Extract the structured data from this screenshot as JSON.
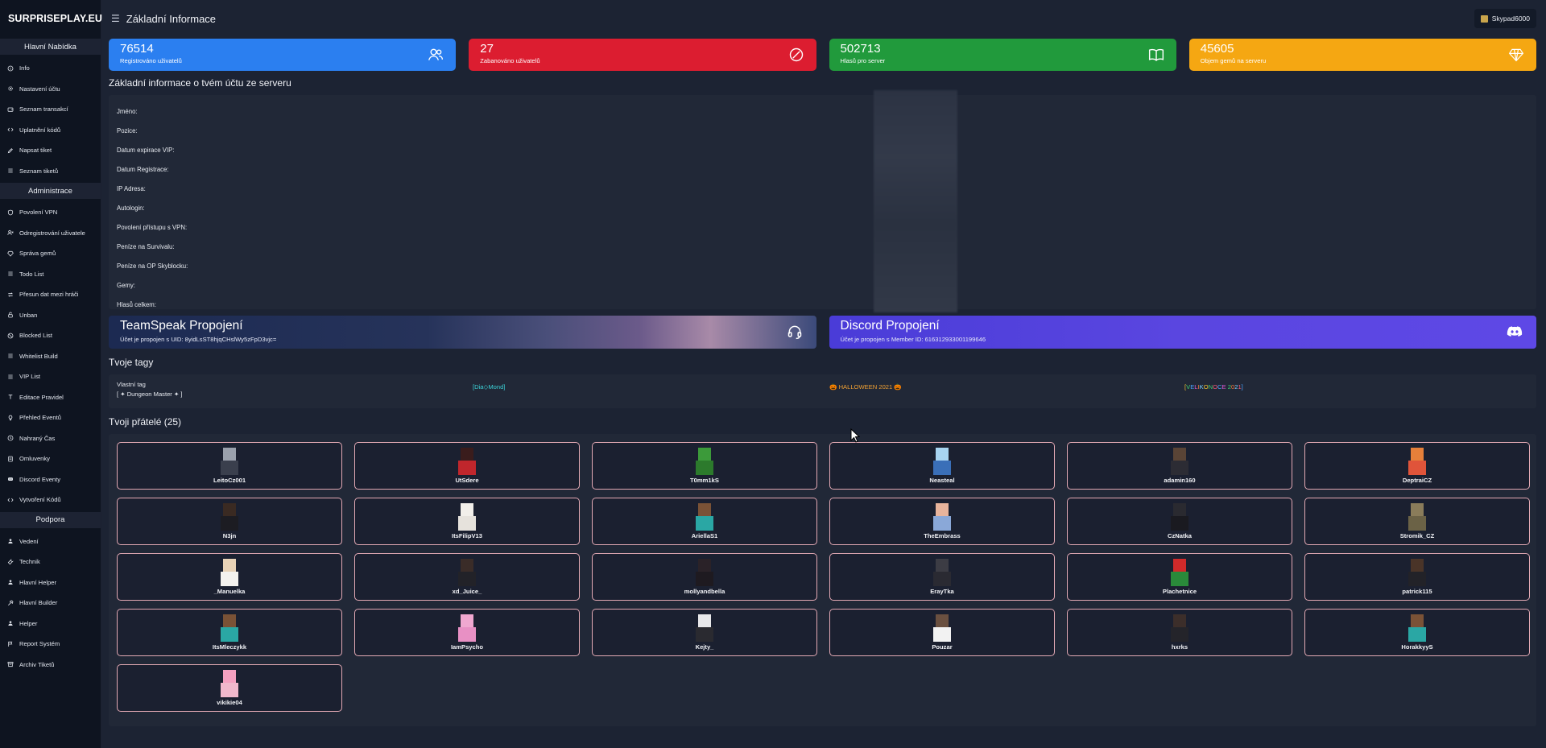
{
  "brand": "SURPRISEPLAY.EU",
  "topbar": {
    "title": "Základní Informace",
    "username": "Skypad6000"
  },
  "sidebar": {
    "sections": [
      {
        "title": "Hlavní Nabídka",
        "items": [
          {
            "label": "Info",
            "icon": "info-icon"
          },
          {
            "label": "Nastavení účtu",
            "icon": "gear-icon"
          },
          {
            "label": "Seznam transakcí",
            "icon": "wallet-icon"
          },
          {
            "label": "Uplatnění kódů",
            "icon": "code-icon"
          },
          {
            "label": "Napsat tiket",
            "icon": "pencil-icon"
          },
          {
            "label": "Seznam tiketů",
            "icon": "list-icon"
          }
        ]
      },
      {
        "title": "Administrace",
        "items": [
          {
            "label": "Povolení VPN",
            "icon": "shield-icon"
          },
          {
            "label": "Odregistrování uživatele",
            "icon": "user-x-icon"
          },
          {
            "label": "Správa gemů",
            "icon": "gem-icon"
          },
          {
            "label": "Todo List",
            "icon": "list-icon"
          },
          {
            "label": "Přesun dat mezi hráči",
            "icon": "transfer-icon"
          },
          {
            "label": "Unban",
            "icon": "unlock-icon"
          },
          {
            "label": "Blocked List",
            "icon": "block-icon"
          },
          {
            "label": "Whitelist Build",
            "icon": "list-icon"
          },
          {
            "label": "VIP List",
            "icon": "list-icon"
          },
          {
            "label": "Editace Pravidel",
            "icon": "text-icon"
          },
          {
            "label": "Přehled Eventů",
            "icon": "bulb-icon"
          },
          {
            "label": "Nahraný Čas",
            "icon": "clock-icon"
          },
          {
            "label": "Omluvenky",
            "icon": "document-icon"
          },
          {
            "label": "Discord Eventy",
            "icon": "discord-icon"
          },
          {
            "label": "Vytvoření Kódů",
            "icon": "code-icon"
          }
        ]
      },
      {
        "title": "Podpora",
        "items": [
          {
            "label": "Vedení",
            "icon": "user-icon"
          },
          {
            "label": "Technik",
            "icon": "wrench-icon"
          },
          {
            "label": "Hlavní Helper",
            "icon": "user-icon"
          },
          {
            "label": "Hlavní Builder",
            "icon": "hammer-icon"
          },
          {
            "label": "Helper",
            "icon": "user-icon"
          },
          {
            "label": "Report Systém",
            "icon": "flag-icon"
          },
          {
            "label": "Archiv Tiketů",
            "icon": "archive-icon"
          }
        ]
      }
    ]
  },
  "stats": [
    {
      "value": "76514",
      "label": "Registrováno uživatelů",
      "color": "#2b7ff0",
      "icon": "users-icon"
    },
    {
      "value": "27",
      "label": "Zabanováno uživatelů",
      "color": "#dc1d30",
      "icon": "ban-icon"
    },
    {
      "value": "502713",
      "label": "Hlasů pro server",
      "color": "#219a3c",
      "icon": "book-icon"
    },
    {
      "value": "45605",
      "label": "Objem gemů na serveru",
      "color": "#f5a712",
      "icon": "diamond-icon"
    }
  ],
  "info": {
    "heading": "Základní informace o tvém účtu ze serveru",
    "rows": [
      "Jméno:",
      "Pozice:",
      "Datum expirace VIP:",
      "Datum Registrace:",
      "IP Adresa:",
      "Autologin:",
      "Povolení přístupu s VPN:",
      "Peníze na Survivalu:",
      "Peníze na OP Skyblocku:",
      "Gemy:",
      "Hlasů celkem:"
    ]
  },
  "banners": {
    "teamspeak": {
      "title": "TeamSpeak Propojení",
      "subtitle": "Účet je propojen s UID: 8yidLsST8hjqCHslWy5zFpD3vjc=",
      "icon": "headset-icon"
    },
    "discord": {
      "title": "Discord Propojení",
      "subtitle": "Účet je propojen s Member ID: 616312933001199646",
      "icon": "discord-icon"
    }
  },
  "tags": {
    "heading": "Tvoje tagy",
    "custom_label": "Vlastní tag",
    "custom_value": "[ ✦ Dungeon Master ✦ ]",
    "items": [
      {
        "text": "[Dia◇Mond]",
        "color": "#3bd1d6"
      },
      {
        "text": "🎃 HALLOWEEN 2021 🎃",
        "color": "#f0a033"
      },
      {
        "text": "[VELIKONOCE 2021]",
        "color": "multicolor"
      }
    ]
  },
  "friends": {
    "heading": "Tvoji přátelé (25)",
    "list": [
      {
        "name": "LeitoCz001",
        "head": "#9aa0ac",
        "body": "#3a3f4d"
      },
      {
        "name": "UtSdere",
        "head": "#3a1c1c",
        "body": "#c0262c"
      },
      {
        "name": "T0mm1kS",
        "head": "#3c9a3a",
        "body": "#2c7a2c"
      },
      {
        "name": "Neasteal",
        "head": "#a8d4f0",
        "body": "#3a6fb8"
      },
      {
        "name": "adamin160",
        "head": "#5a4436",
        "body": "#2c2c34"
      },
      {
        "name": "DeptraiCZ",
        "head": "#e6803a",
        "body": "#e0543a"
      },
      {
        "name": "N3jn",
        "head": "#3a2a22",
        "body": "#1c1c22"
      },
      {
        "name": "ItsFilipV13",
        "head": "#f2efea",
        "body": "#e6e2dc"
      },
      {
        "name": "AriellaS1",
        "head": "#7a5236",
        "body": "#2aa7a4"
      },
      {
        "name": "TheEmbrass",
        "head": "#e8b49c",
        "body": "#8aa8d8"
      },
      {
        "name": "CzNatka",
        "head": "#2a2a30",
        "body": "#1a1a20"
      },
      {
        "name": "Stromik_CZ",
        "head": "#8a7c5a",
        "body": "#6b6246"
      },
      {
        "name": "_Manuelka",
        "head": "#e8d2b6",
        "body": "#f4f2ee"
      },
      {
        "name": "xd_Juice_",
        "head": "#3a2c28",
        "body": "#222228"
      },
      {
        "name": "mollyandbella",
        "head": "#2a2228",
        "body": "#1e1a20"
      },
      {
        "name": "ErayTka",
        "head": "#3c3c44",
        "body": "#2a2a32"
      },
      {
        "name": "Plachetnice",
        "head": "#d02a2a",
        "body": "#2a8a3a"
      },
      {
        "name": "patrick115",
        "head": "#4a3428",
        "body": "#222228"
      },
      {
        "name": "ItsMleczykk",
        "head": "#7a5236",
        "body": "#2aa7a4"
      },
      {
        "name": "IamPsycho",
        "head": "#f0a8d0",
        "body": "#e890c4"
      },
      {
        "name": "Kejty_",
        "head": "#e8e8ea",
        "body": "#2a2a30"
      },
      {
        "name": "Pouzar",
        "head": "#6a5040",
        "body": "#f2f2f2"
      },
      {
        "name": "hxrks",
        "head": "#3c2e2a",
        "body": "#24242a"
      },
      {
        "name": "HorakkyyS",
        "head": "#7a5236",
        "body": "#2aa7a4"
      },
      {
        "name": "vikikie04",
        "head": "#f4a0c0",
        "body": "#f0b8cc"
      }
    ]
  }
}
